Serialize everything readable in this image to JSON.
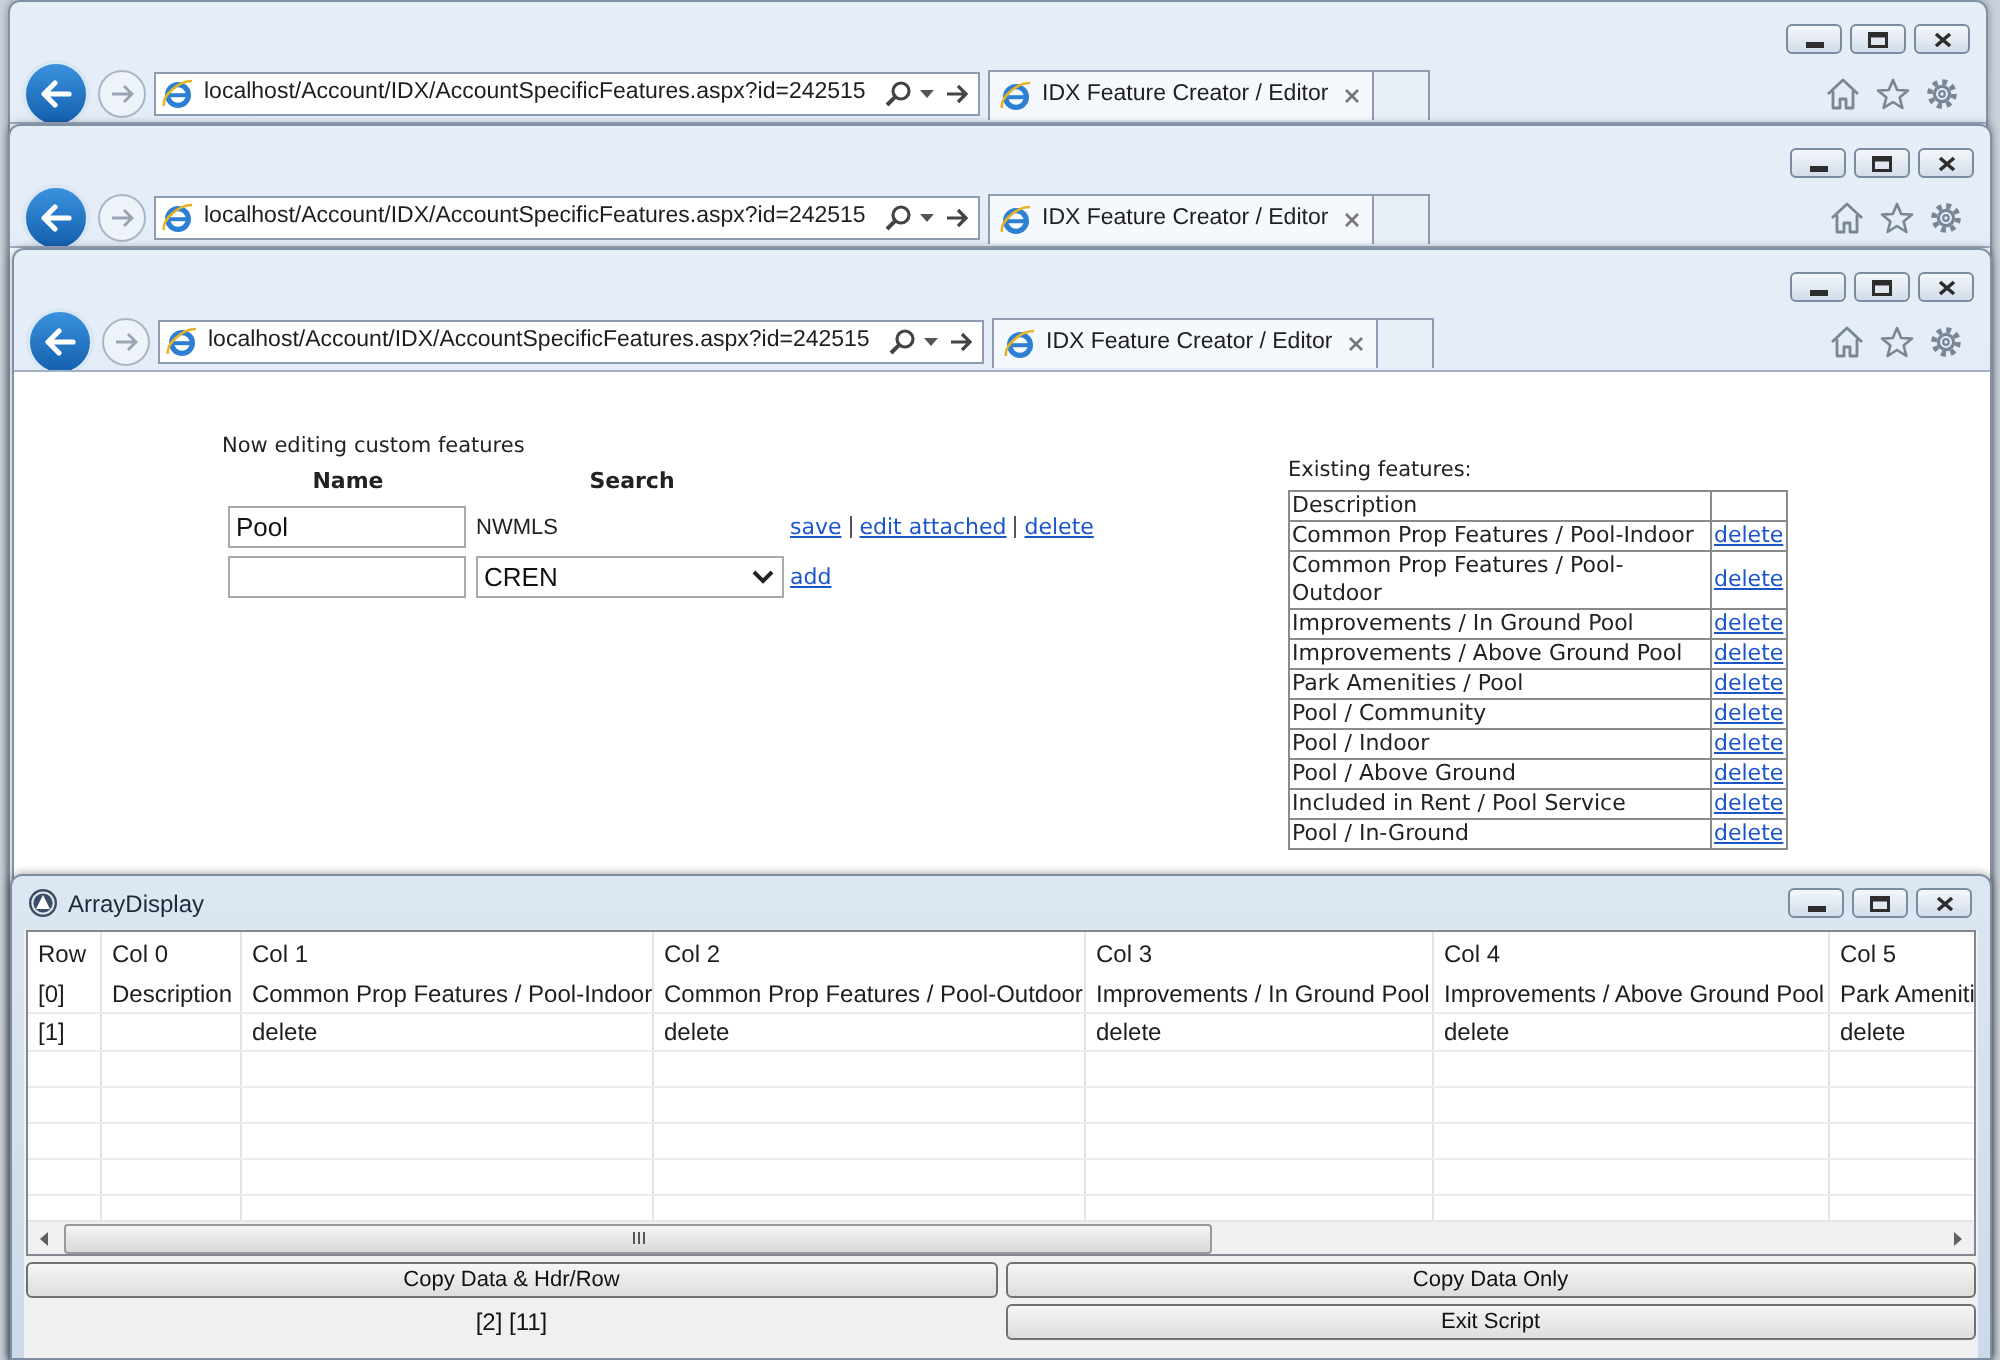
{
  "browser_windows": [
    {
      "address": "localhost/Account/IDX/AccountSpecificFeatures.aspx?id=242515",
      "tab_title": "IDX Feature Creator / Editor"
    },
    {
      "address": "localhost/Account/IDX/AccountSpecificFeatures.aspx?id=242515",
      "tab_title": "IDX Feature Creator / Editor"
    },
    {
      "address": "localhost/Account/IDX/AccountSpecificFeatures.aspx?id=242515",
      "tab_title": "IDX Feature Creator / Editor"
    }
  ],
  "editor": {
    "heading": "Now editing custom features",
    "columns": [
      "Name",
      "Search"
    ],
    "feature": {
      "name": "Pool",
      "search": "NWMLS",
      "links": [
        "save",
        "edit attached",
        "delete"
      ]
    },
    "new_feature": {
      "search": "CREN",
      "link": "add"
    }
  },
  "existing_features": {
    "label": "Existing features:",
    "header": "Description",
    "rows": [
      {
        "description": "Common Prop Features / Pool-Indoor",
        "link": "delete"
      },
      {
        "description": "Common Prop Features / Pool-Outdoor",
        "link": "delete"
      },
      {
        "description": "Improvements / In Ground Pool",
        "link": "delete"
      },
      {
        "description": "Improvements / Above Ground Pool",
        "link": "delete"
      },
      {
        "description": "Park Amenities / Pool",
        "link": "delete"
      },
      {
        "description": "Pool / Community",
        "link": "delete"
      },
      {
        "description": "Pool / Indoor",
        "link": "delete"
      },
      {
        "description": "Pool / Above Ground",
        "link": "delete"
      },
      {
        "description": "Included in Rent / Pool Service",
        "link": "delete"
      },
      {
        "description": "Pool / In-Ground",
        "link": "delete"
      }
    ]
  },
  "array_display": {
    "title": "ArrayDisplay",
    "columns": [
      "Row",
      "Col 0",
      "Col 1",
      "Col 2",
      "Col 3",
      "Col 4",
      "Col 5"
    ],
    "rows": [
      [
        "[0]",
        "Description",
        "Common Prop Features / Pool-Indoor",
        "Common Prop Features / Pool-Outdoor",
        "Improvements / In Ground Pool",
        "Improvements / Above Ground Pool",
        "Park Ameniti"
      ],
      [
        "[1]",
        null,
        "delete",
        "delete",
        "delete",
        "delete",
        "delete"
      ]
    ],
    "buttons": [
      {
        "label": "Copy Data & Hdr/Row"
      },
      {
        "label": "Copy Data Only"
      },
      {
        "label": "Exit Script"
      }
    ],
    "status": "[2] [11]"
  }
}
